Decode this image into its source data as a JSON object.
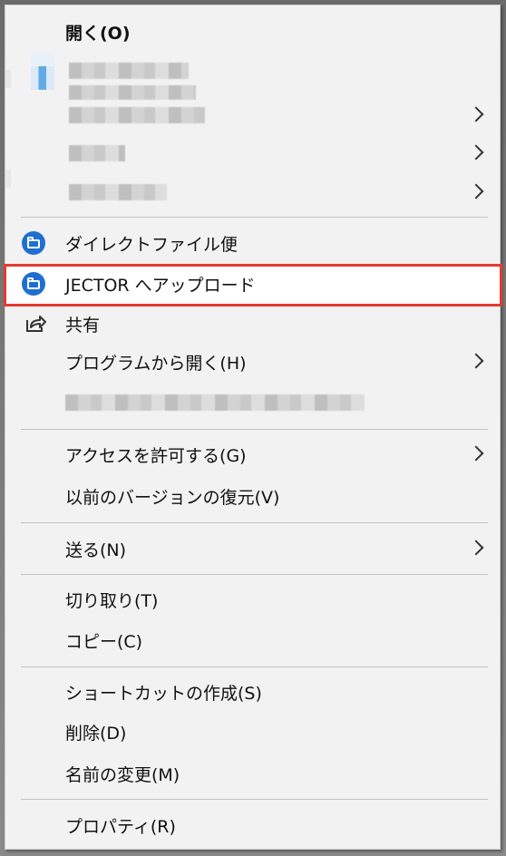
{
  "menu": {
    "open": "開く(O)",
    "jector_upload": "JECTOR へアップロード",
    "direct_file": "ダイレクトファイル便",
    "share": "共有",
    "open_with": "プログラムから開く(H)",
    "give_access": "アクセスを許可する(G)",
    "restore_prev": "以前のバージョンの復元(V)",
    "send_to": "送る(N)",
    "cut": "切り取り(T)",
    "copy": "コピー(C)",
    "create_shortcut": "ショートカットの作成(S)",
    "delete": "削除(D)",
    "rename": "名前の変更(M)",
    "properties": "プロパティ(R)"
  },
  "colors": {
    "highlight_border": "#e53b2e",
    "app_icon_blue": "#1f6fd1"
  },
  "icons": {
    "chevron": "chevron-right-icon",
    "app": "folder-app-icon",
    "share": "share-icon"
  }
}
